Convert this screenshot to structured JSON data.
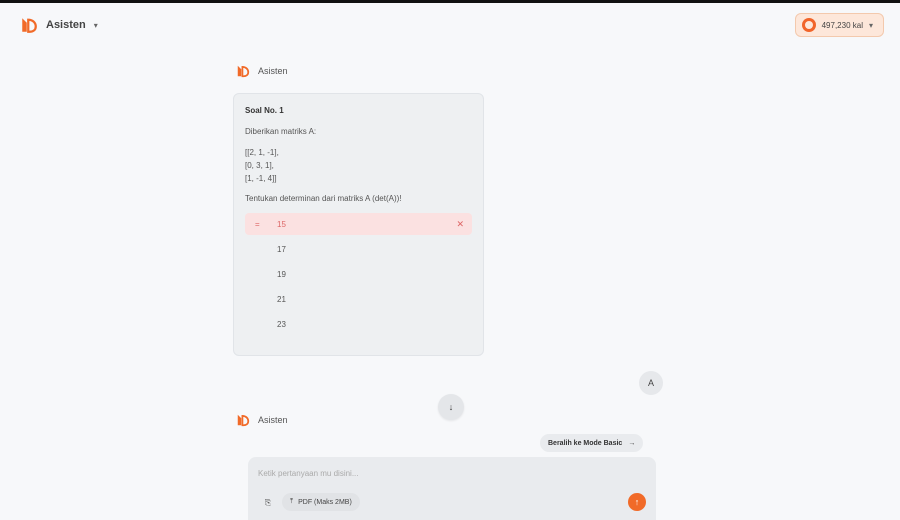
{
  "header": {
    "app_name": "Asisten",
    "credits": "497,230 kal"
  },
  "assistant_label_top": "Asisten",
  "assistant_label_bottom": "Asisten",
  "question": {
    "title": "Soal No. 1",
    "intro": "Diberikan matriks A:",
    "matrix_rows": [
      "[[2, 1, -1],",
      "[0, 3, 1],",
      "[1, -1, 4]]"
    ],
    "instruction": "Tentukan determinan dari matriks A (det(A))!",
    "options": [
      {
        "label": "15",
        "state": "wrong"
      },
      {
        "label": "17",
        "state": "none"
      },
      {
        "label": "19",
        "state": "none"
      },
      {
        "label": "21",
        "state": "none"
      },
      {
        "label": "23",
        "state": "none"
      }
    ]
  },
  "user_message": "A",
  "mode_switch_label": "Beralih ke Mode Basic",
  "composer": {
    "placeholder": "Ketik pertanyaan mu disini...",
    "pdf_label": "PDF (Maks 2MB)"
  },
  "icons": {
    "logo": "brand-logo-icon",
    "credit": "credit-flame-icon",
    "scroll": "arrow-down-icon",
    "attach": "attach-icon",
    "upload": "upload-icon",
    "send": "arrow-up-icon",
    "mode_arrow": "arrow-right-icon",
    "close": "close-icon"
  },
  "colors": {
    "accent": "#f16a28",
    "wrong_bg": "#fbe1e1",
    "wrong_text": "#d66666"
  }
}
